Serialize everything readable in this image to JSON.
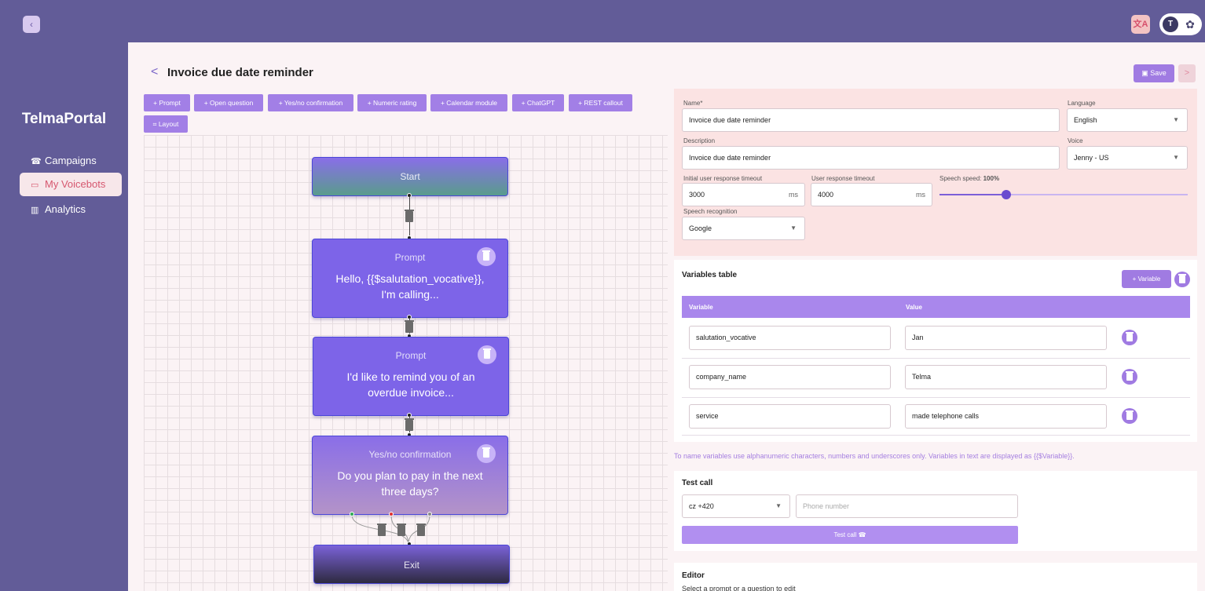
{
  "app": {
    "brand": "TelmaPortal",
    "back_icon": "‹",
    "translate_icon": "文A",
    "user_initial": "T",
    "gear_icon": "✿"
  },
  "sidebar": {
    "items": [
      {
        "label": "Campaigns",
        "icon": "☎"
      },
      {
        "label": "My Voicebots",
        "icon": "▭"
      },
      {
        "label": "Analytics",
        "icon": "▥"
      }
    ]
  },
  "header": {
    "back": "<",
    "title": "Invoice due date reminder",
    "save_label": "Save",
    "next": ">"
  },
  "toolbar": {
    "items": [
      "+  Prompt",
      "+  Open question",
      "+  Yes/no confirmation",
      "+  Numeric rating",
      "+  Calendar module",
      "+  ChatGPT",
      "+  REST callout"
    ],
    "layout_label": "Layout",
    "layout_icon": "⌗"
  },
  "flow": {
    "start": "Start",
    "nodes": [
      {
        "type": "Prompt",
        "text": "Hello, {{$salutation_vocative}}, I'm calling..."
      },
      {
        "type": "Prompt",
        "text": "I'd like to remind you of an overdue invoice..."
      },
      {
        "type": "Yes/no confirmation",
        "text": "Do you plan to pay in the next three days?"
      }
    ],
    "exit": "Exit"
  },
  "settings": {
    "name_label": "Name*",
    "name_value": "Invoice due date reminder",
    "language_label": "Language",
    "language_value": "English",
    "description_label": "Description",
    "description_value": "Invoice due date reminder",
    "voice_label": "Voice",
    "voice_value": "Jenny - US",
    "initial_timeout_label": "Initial user response timeout",
    "initial_timeout_value": "3000",
    "timeout_label": "User response timeout",
    "timeout_value": "4000",
    "unit": "ms",
    "speed_label": "Speech speed: ",
    "speed_value": "100%",
    "speed_fraction": 0.27,
    "recognition_label": "Speech recognition",
    "recognition_value": "Google"
  },
  "variables": {
    "title": "Variables table",
    "add_label": "+  Variable",
    "col_variable": "Variable",
    "col_value": "Value",
    "rows": [
      {
        "name": "salutation_vocative",
        "value": "Jan"
      },
      {
        "name": "company_name",
        "value": "Telma"
      },
      {
        "name": "service",
        "value": "made telephone calls"
      }
    ],
    "hint": "To name variables use alphanumeric characters, numbers and underscores only. Variables in text are displayed as {{$Variable}}."
  },
  "test_call": {
    "title": "Test call",
    "country": "cz +420",
    "phone_placeholder": "Phone number",
    "button_label": "Test call",
    "phone_icon": "☎"
  },
  "editor": {
    "title": "Editor",
    "hint": "Select a prompt or a question to edit"
  },
  "colors": {
    "bar": "#625c98",
    "accent": "#a07be2",
    "node": "#7d64e8"
  }
}
